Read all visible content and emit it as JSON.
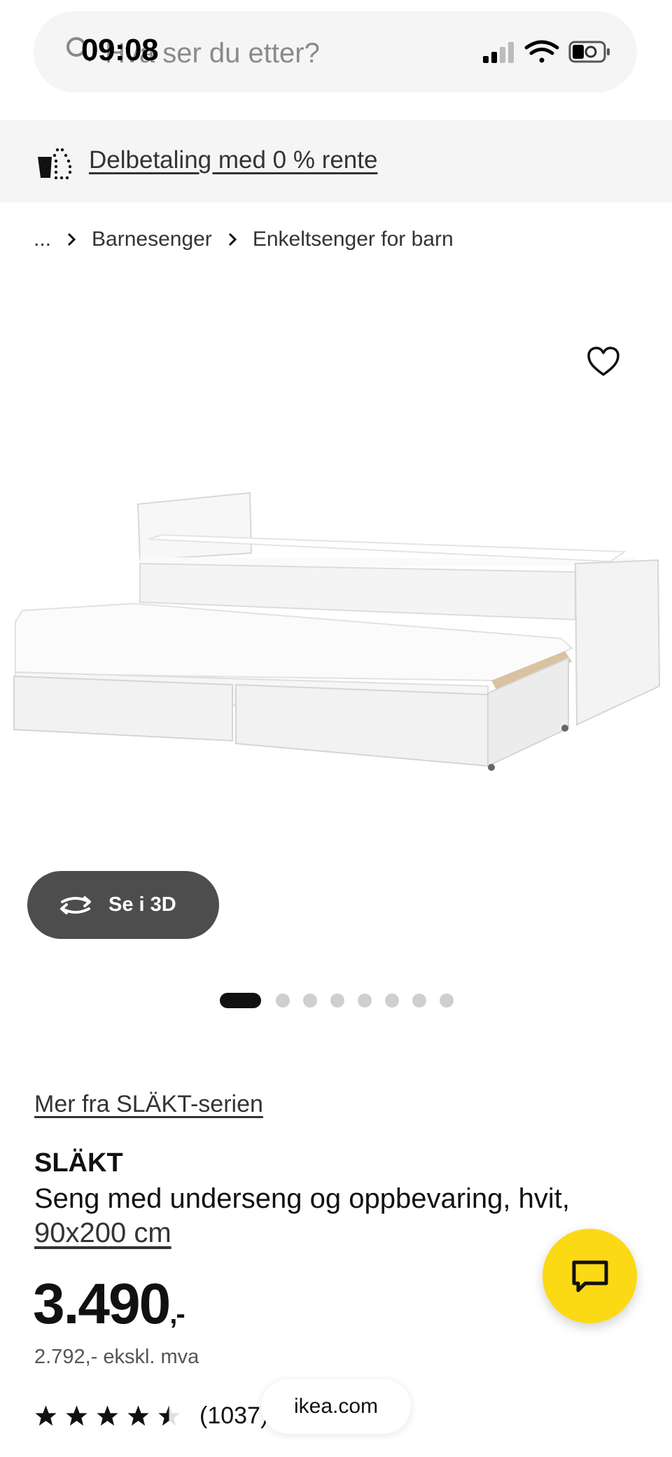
{
  "search": {
    "placeholder": "Hva ser du etter?"
  },
  "status_bar": {
    "time": "09:08",
    "icons": [
      "signal-icon",
      "wifi-icon",
      "battery-icon"
    ]
  },
  "promo": {
    "label": "Delbetaling med 0 % rente",
    "icon": "installment-icon"
  },
  "breadcrumb": {
    "items": [
      "...",
      "Barnesenger",
      "Enkeltsenger for barn"
    ]
  },
  "gallery": {
    "view_3d_label": "Se i 3D",
    "dot_count": 8,
    "active_index": 0
  },
  "product": {
    "series_link": "Mer fra SLÄKT-serien",
    "name": "SLÄKT",
    "description": "Seng med underseng og oppbevaring, hvit,",
    "size": "90x200 cm",
    "price_main": "3.490",
    "price_suffix": ",-",
    "price_ex_vat": "2.792,- ekskl. mva",
    "rating_value": 4.5,
    "rating_count": "(1037)"
  },
  "browser": {
    "url": "ikea.com"
  },
  "colors": {
    "accent_yellow": "#fbd914",
    "dark_button": "#4d4d4d",
    "banner_bg": "#f5f5f5"
  }
}
